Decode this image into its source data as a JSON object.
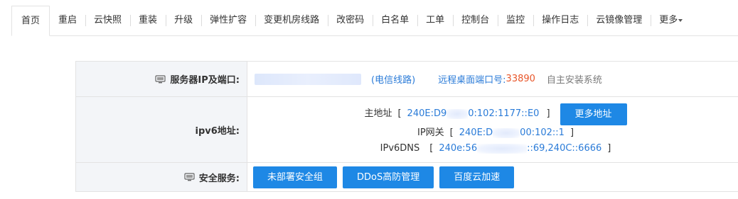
{
  "tabs": [
    {
      "label": "首页",
      "active": true
    },
    {
      "label": "重启"
    },
    {
      "label": "云快照"
    },
    {
      "label": "重装"
    },
    {
      "label": "升级"
    },
    {
      "label": "弹性扩容"
    },
    {
      "label": "变更机房线路"
    },
    {
      "label": "改密码"
    },
    {
      "label": "白名单"
    },
    {
      "label": "工单"
    },
    {
      "label": "控制台"
    },
    {
      "label": "监控"
    },
    {
      "label": "操作日志"
    },
    {
      "label": "云镜像管理"
    },
    {
      "label": "更多"
    }
  ],
  "server_ip": {
    "label": "服务器IP及端口:",
    "line_type": "(电信线路)",
    "rdp_label": "远程桌面端口号:",
    "rdp_port": "33890",
    "install_note": "自主安装系统"
  },
  "ipv6": {
    "label": "ipv6地址:",
    "main_label": "主地址",
    "main_prefix": "240E:D9",
    "main_suffix": "0:102:1177::E0",
    "more_button": "更多地址",
    "gateway_label": "IP网关",
    "gateway_prefix": "240E:D",
    "gateway_suffix": "00:102::1",
    "dns_label": "IPv6DNS",
    "dns_prefix": "240e:56",
    "dns_suffix": "::69,240C::6666",
    "open_bracket": "[",
    "close_bracket": "]"
  },
  "security": {
    "label": "安全服务:",
    "buttons": [
      "未部署安全组",
      "DDoS高防管理",
      "百度云加速"
    ]
  },
  "colors": {
    "accent": "#1e88e5",
    "link": "#2a7bd8",
    "port": "#e8562a",
    "label_bg": "#f3f5f8"
  }
}
